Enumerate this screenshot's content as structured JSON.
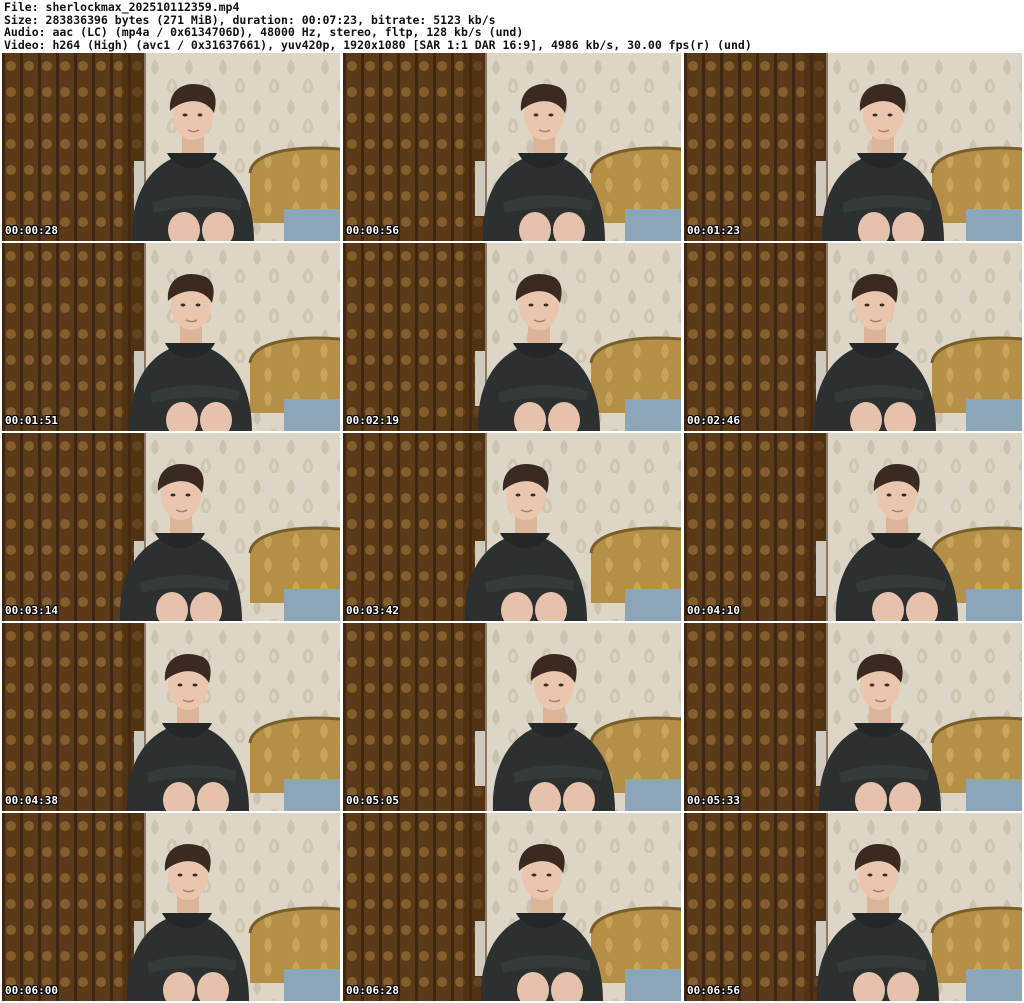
{
  "header": {
    "file": "File: sherlockmax_202510112359.mp4",
    "size": "Size: 283836396 bytes (271 MiB), duration: 00:07:23, bitrate: 5123 kb/s",
    "audio": "Audio: aac (LC) (mp4a / 0x6134706D), 48000 Hz, stereo, fltp, 128 kb/s (und)",
    "video": "Video: h264 (High) (avc1 / 0x31637661), yuv420p, 1920x1080 [SAR 1:1 DAR 16:9], 4986 kb/s, 30.00 fps(r) (und)"
  },
  "thumbnails": [
    {
      "time": "00:00:28"
    },
    {
      "time": "00:00:56"
    },
    {
      "time": "00:01:23"
    },
    {
      "time": "00:01:51"
    },
    {
      "time": "00:02:19"
    },
    {
      "time": "00:02:46"
    },
    {
      "time": "00:03:14"
    },
    {
      "time": "00:03:42"
    },
    {
      "time": "00:04:10"
    },
    {
      "time": "00:04:38"
    },
    {
      "time": "00:05:05"
    },
    {
      "time": "00:05:33"
    },
    {
      "time": "00:06:00"
    },
    {
      "time": "00:06:28"
    },
    {
      "time": "00:06:56"
    }
  ]
}
